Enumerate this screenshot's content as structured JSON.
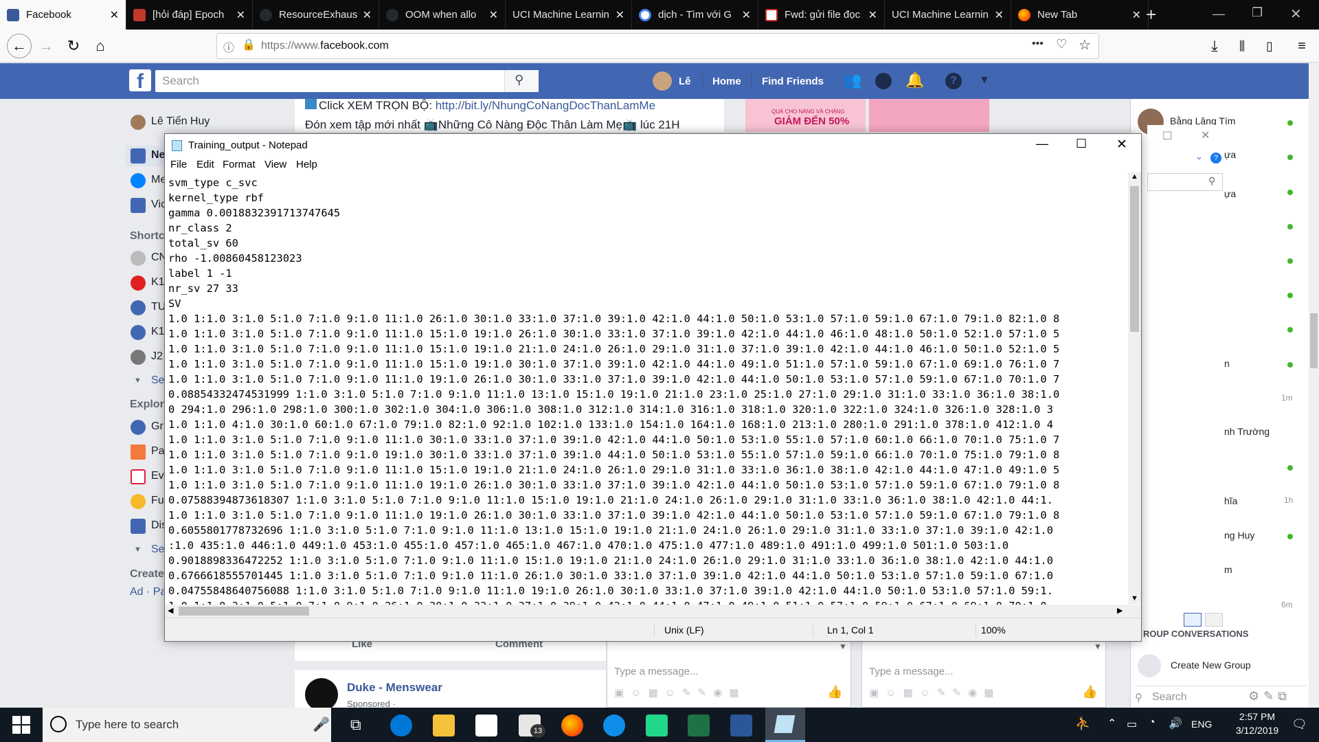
{
  "browser": {
    "tabs": [
      {
        "title": "Facebook",
        "color": "#3b5998"
      },
      {
        "title": "[hỏi đáp] Epoch",
        "color": "#c0392b"
      },
      {
        "title": "ResourceExhaus",
        "color": "#24292e"
      },
      {
        "title": "OOM when allo",
        "color": "#24292e"
      },
      {
        "title": "UCI Machine Learnin",
        "color": ""
      },
      {
        "title": "dịch - Tìm với G",
        "color": "#4285f4"
      },
      {
        "title": "Fwd: gửi file đọc",
        "color": "#d93025"
      },
      {
        "title": "UCI Machine Learnin",
        "color": ""
      },
      {
        "title": "New Tab",
        "color": "#ff9400"
      }
    ],
    "url_prefix": "https://www.",
    "url_host": "facebook.com",
    "page_actions": "•••"
  },
  "facebook": {
    "search_placeholder": "Search",
    "user_name": "Lê",
    "nav_home": "Home",
    "nav_find_friends": "Find Friends",
    "profile_name": "Lê Tiến Huy",
    "left_items": [
      "Ne",
      "Me",
      "Vic"
    ],
    "shortcuts_label": "Shortc",
    "shortcut_items": [
      "CN",
      "K1",
      "TU",
      "K1",
      "J2"
    ],
    "see_more": "Se",
    "explore_label": "Explor",
    "explore_items": [
      "Gr",
      "Pa",
      "Ev",
      "Fu",
      "Dis"
    ],
    "see_more2": "Se",
    "create_label": "Create",
    "create_items": "Ad · Pa",
    "post_link_prefix": "Click XEM TRỌN BỘ: ",
    "post_link": "http://bit.ly/NhungCoNangDocThanLamMe",
    "post_line2": "Đón xem tập mới nhất 📺Những Cô Nàng Độc Thân Làm Mẹ📺 lúc 21H",
    "ad_text1": "QUÀ CHO NÀNG VÀ CHÀNG",
    "ad_text2": "GIẢM ĐẾN 50%",
    "like": "Like",
    "comment": "Comment",
    "duke_name": "Duke - Menswear",
    "duke_sub": "Sponsored · ",
    "message_placeholder": "Type a message...",
    "chat_names": [
      "Bằng Lăng Tím",
      "ựa",
      "n",
      "nh Trường",
      "hĩa",
      "ng Huy",
      "m"
    ],
    "chat_times": [
      "1m",
      "1h",
      "6m"
    ],
    "group_conversations": "ROUP CONVERSATIONS",
    "create_new_group": "Create New Group",
    "chat_search": "Search"
  },
  "notepad": {
    "title": "Training_output - Notepad",
    "menu": [
      "File",
      "Edit",
      "Format",
      "View",
      "Help"
    ],
    "lines": [
      "svm_type c_svc",
      "kernel_type rbf",
      "gamma 0.0018832391713747645",
      "nr_class 2",
      "total_sv 60",
      "rho -1.00860458123023",
      "label 1 -1",
      "nr_sv 27 33",
      "SV",
      "1.0 1:1.0 3:1.0 5:1.0 7:1.0 9:1.0 11:1.0 26:1.0 30:1.0 33:1.0 37:1.0 39:1.0 42:1.0 44:1.0 50:1.0 53:1.0 57:1.0 59:1.0 67:1.0 79:1.0 82:1.0 8",
      "1.0 1:1.0 3:1.0 5:1.0 7:1.0 9:1.0 11:1.0 15:1.0 19:1.0 26:1.0 30:1.0 33:1.0 37:1.0 39:1.0 42:1.0 44:1.0 46:1.0 48:1.0 50:1.0 52:1.0 57:1.0 5",
      "1.0 1:1.0 3:1.0 5:1.0 7:1.0 9:1.0 11:1.0 15:1.0 19:1.0 21:1.0 24:1.0 26:1.0 29:1.0 31:1.0 37:1.0 39:1.0 42:1.0 44:1.0 46:1.0 50:1.0 52:1.0 5",
      "1.0 1:1.0 3:1.0 5:1.0 7:1.0 9:1.0 11:1.0 15:1.0 19:1.0 30:1.0 37:1.0 39:1.0 42:1.0 44:1.0 49:1.0 51:1.0 57:1.0 59:1.0 67:1.0 69:1.0 76:1.0 7",
      "1.0 1:1.0 3:1.0 5:1.0 7:1.0 9:1.0 11:1.0 19:1.0 26:1.0 30:1.0 33:1.0 37:1.0 39:1.0 42:1.0 44:1.0 50:1.0 53:1.0 57:1.0 59:1.0 67:1.0 70:1.0 7",
      "0.08854332474531999 1:1.0 3:1.0 5:1.0 7:1.0 9:1.0 11:1.0 13:1.0 15:1.0 19:1.0 21:1.0 23:1.0 25:1.0 27:1.0 29:1.0 31:1.0 33:1.0 36:1.0 38:1.0",
      "0 294:1.0 296:1.0 298:1.0 300:1.0 302:1.0 304:1.0 306:1.0 308:1.0 312:1.0 314:1.0 316:1.0 318:1.0 320:1.0 322:1.0 324:1.0 326:1.0 328:1.0 3",
      "1.0 1:1.0 4:1.0 30:1.0 60:1.0 67:1.0 79:1.0 82:1.0 92:1.0 102:1.0 133:1.0 154:1.0 164:1.0 168:1.0 213:1.0 280:1.0 291:1.0 378:1.0 412:1.0 4",
      "1.0 1:1.0 3:1.0 5:1.0 7:1.0 9:1.0 11:1.0 30:1.0 33:1.0 37:1.0 39:1.0 42:1.0 44:1.0 50:1.0 53:1.0 55:1.0 57:1.0 60:1.0 66:1.0 70:1.0 75:1.0 7",
      "1.0 1:1.0 3:1.0 5:1.0 7:1.0 9:1.0 19:1.0 30:1.0 33:1.0 37:1.0 39:1.0 44:1.0 50:1.0 53:1.0 55:1.0 57:1.0 59:1.0 66:1.0 70:1.0 75:1.0 79:1.0 8",
      "1.0 1:1.0 3:1.0 5:1.0 7:1.0 9:1.0 11:1.0 15:1.0 19:1.0 21:1.0 24:1.0 26:1.0 29:1.0 31:1.0 33:1.0 36:1.0 38:1.0 42:1.0 44:1.0 47:1.0 49:1.0 5",
      "1.0 1:1.0 3:1.0 5:1.0 7:1.0 9:1.0 11:1.0 19:1.0 26:1.0 30:1.0 33:1.0 37:1.0 39:1.0 42:1.0 44:1.0 50:1.0 53:1.0 57:1.0 59:1.0 67:1.0 79:1.0 8",
      "0.07588394873618307 1:1.0 3:1.0 5:1.0 7:1.0 9:1.0 11:1.0 15:1.0 19:1.0 21:1.0 24:1.0 26:1.0 29:1.0 31:1.0 33:1.0 36:1.0 38:1.0 42:1.0 44:1.",
      "1.0 1:1.0 3:1.0 5:1.0 7:1.0 9:1.0 11:1.0 19:1.0 26:1.0 30:1.0 33:1.0 37:1.0 39:1.0 42:1.0 44:1.0 50:1.0 53:1.0 57:1.0 59:1.0 67:1.0 79:1.0 8",
      "0.6055801778732696 1:1.0 3:1.0 5:1.0 7:1.0 9:1.0 11:1.0 13:1.0 15:1.0 19:1.0 21:1.0 24:1.0 26:1.0 29:1.0 31:1.0 33:1.0 37:1.0 39:1.0 42:1.0",
      ":1.0 435:1.0 446:1.0 449:1.0 453:1.0 455:1.0 457:1.0 465:1.0 467:1.0 470:1.0 475:1.0 477:1.0 489:1.0 491:1.0 499:1.0 501:1.0 503:1.0",
      "0.9018898336472252 1:1.0 3:1.0 5:1.0 7:1.0 9:1.0 11:1.0 15:1.0 19:1.0 21:1.0 24:1.0 26:1.0 29:1.0 31:1.0 33:1.0 36:1.0 38:1.0 42:1.0 44:1.0",
      "0.6766618555701445 1:1.0 3:1.0 5:1.0 7:1.0 9:1.0 11:1.0 26:1.0 30:1.0 33:1.0 37:1.0 39:1.0 42:1.0 44:1.0 50:1.0 53:1.0 57:1.0 59:1.0 67:1.0",
      "0.04755848640756088 1:1.0 3:1.0 5:1.0 7:1.0 9:1.0 11:1.0 19:1.0 26:1.0 30:1.0 33:1.0 37:1.0 39:1.0 42:1.0 44:1.0 50:1.0 53:1.0 57:1.0 59:1.",
      "1.0 1:1.0 3:1.0 5:1.0 7:1.0 9:1.0 26:1.0 30:1.0 33:1.0 37:1.0 39:1.0 42:1.0 44:1.0 47:1.0 49:1.0 51:1.0 57:1.0 59:1.0 67:1.0 69:1.0 70:1.0"
    ],
    "status_eol": "Unix (LF)",
    "status_pos": "Ln 1, Col 1",
    "status_zoom": "100%"
  },
  "taskbar": {
    "search_placeholder": "Type here to search",
    "mail_badge": "13",
    "language": "ENG",
    "time": "2:57 PM",
    "date": "3/12/2019"
  },
  "colors": {
    "facebook_blue": "#4267b2",
    "taskbar": "#101822",
    "online_green": "#42b72a"
  }
}
